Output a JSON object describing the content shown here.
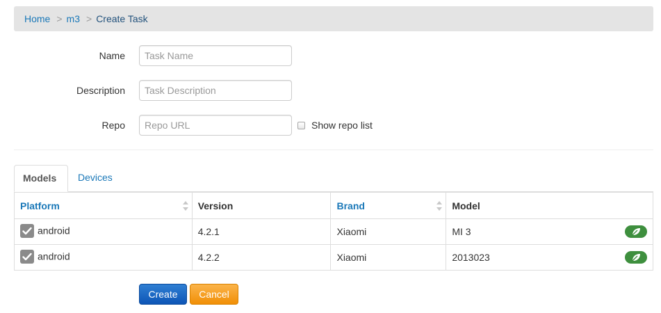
{
  "breadcrumb": {
    "items": [
      "Home",
      "m3"
    ],
    "separator": ">",
    "current": "Create Task"
  },
  "form": {
    "name": {
      "label": "Name",
      "placeholder": "Task Name",
      "value": ""
    },
    "description": {
      "label": "Description",
      "placeholder": "Task Description",
      "value": ""
    },
    "repo": {
      "label": "Repo",
      "placeholder": "Repo URL",
      "value": ""
    },
    "show_repo_list": {
      "label": "Show repo list",
      "checked": false
    }
  },
  "tabs": [
    {
      "label": "Models",
      "active": true
    },
    {
      "label": "Devices",
      "active": false
    }
  ],
  "table": {
    "columns": [
      {
        "label": "Platform",
        "sortable": true
      },
      {
        "label": "Version",
        "sortable": false
      },
      {
        "label": "Brand",
        "sortable": true
      },
      {
        "label": "Model",
        "sortable": false
      }
    ],
    "rows": [
      {
        "checked": true,
        "platform": "android",
        "version": "4.2.1",
        "brand": "Xiaomi",
        "model": "MI 3",
        "action_icon": "leaf-icon"
      },
      {
        "checked": true,
        "platform": "android",
        "version": "4.2.2",
        "brand": "Xiaomi",
        "model": "2013023",
        "action_icon": "leaf-icon"
      }
    ]
  },
  "actions": {
    "create_label": "Create",
    "cancel_label": "Cancel"
  },
  "colors": {
    "link": "#1a78b8",
    "primary": "#0d55b6",
    "warning": "#f18f06",
    "success": "#3e8f3e",
    "breadcrumb_bg": "#e4e4e4"
  }
}
